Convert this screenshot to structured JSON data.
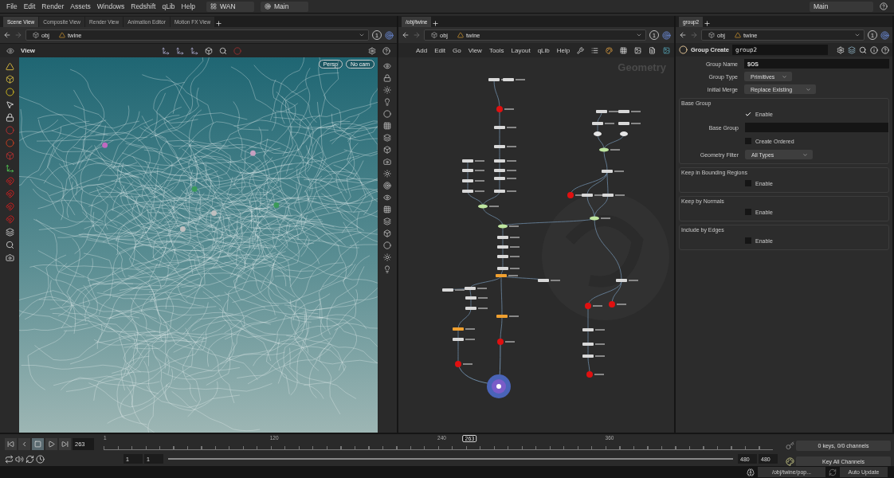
{
  "menu": [
    "File",
    "Edit",
    "Render",
    "Assets",
    "Windows",
    "Redshift",
    "qLib",
    "Help"
  ],
  "desktop": "WAN",
  "scene": "Main",
  "right_menu": "Main",
  "scene_pane": {
    "tabs": [
      {
        "label": "Scene View",
        "selected": true
      },
      {
        "label": "Composite View",
        "selected": false
      },
      {
        "label": "Render View",
        "selected": false
      },
      {
        "label": "Animation Editor",
        "selected": false
      },
      {
        "label": "Motion FX View",
        "selected": false
      }
    ],
    "path": [
      "obj",
      "twine"
    ],
    "pin": "1",
    "view_label": "View",
    "camera_menus": [
      "Persp",
      "No cam"
    ]
  },
  "network_pane": {
    "tabs": [
      {
        "label": "/obj/twine",
        "selected": true
      }
    ],
    "path": [
      "obj",
      "twine"
    ],
    "pin": "1",
    "menu": [
      "Add",
      "Edit",
      "Go",
      "View",
      "Tools",
      "Layout",
      "qLib",
      "Help"
    ],
    "context": "Geometry"
  },
  "param_pane": {
    "tabs": [
      {
        "label": "group2",
        "selected": true
      }
    ],
    "path": [
      "obj",
      "twine"
    ],
    "pin": "1",
    "node_type": "Group Create",
    "node_name": "group2",
    "rows": [
      {
        "kind": "text",
        "label": "Group Name",
        "value": "$OS"
      },
      {
        "kind": "menu",
        "label": "Group Type",
        "value": "Primitives"
      },
      {
        "kind": "menu",
        "label": "Initial Merge",
        "value": "Replace Existing"
      }
    ],
    "sections": [
      {
        "title": "Base Group",
        "rows": [
          {
            "kind": "toggle",
            "label": "Enable",
            "checked": true
          },
          {
            "kind": "text",
            "label": "Base Group"
          },
          {
            "kind": "toggle",
            "label": "Create Ordered",
            "checked": false
          },
          {
            "kind": "menu",
            "label": "Geometry Filter",
            "value": "All Types"
          }
        ]
      },
      {
        "title": "Keep in Bounding Regions",
        "rows": [
          {
            "kind": "toggle",
            "label": "Enable",
            "checked": false
          }
        ]
      },
      {
        "title": "Keep by Normals",
        "rows": [
          {
            "kind": "toggle",
            "label": "Enable",
            "checked": false
          }
        ]
      },
      {
        "title": "Include by Edges",
        "rows": [
          {
            "kind": "toggle",
            "label": "Enable",
            "checked": false
          }
        ]
      }
    ]
  },
  "timeline": {
    "current_frame": "263",
    "ticks": [
      "1",
      "120",
      "240",
      "360"
    ],
    "marker": "263",
    "range_start": [
      "1",
      "1"
    ],
    "range_bar": {
      "level": 1
    },
    "range_end": [
      "480",
      "480"
    ],
    "keys": "0 keys, 0/0 channels",
    "key_button": "Key All Channels"
  },
  "status_bar": {
    "path": "/obj/twine/pop...",
    "update": "Auto Update"
  }
}
